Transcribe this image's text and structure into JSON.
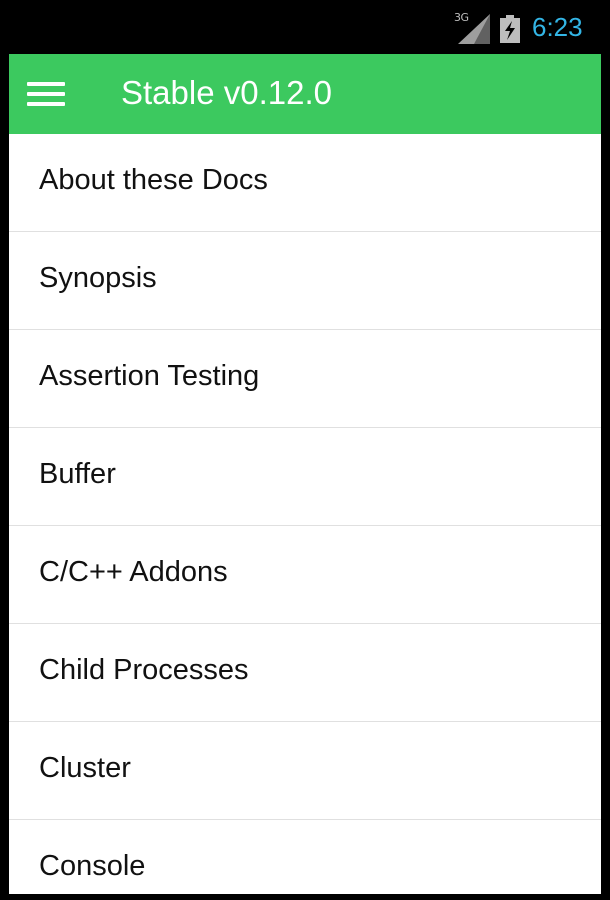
{
  "status_bar": {
    "network": "3G",
    "time": "6:23",
    "signal_icon": "signal-icon",
    "battery_icon": "battery-charging-icon",
    "time_color": "#33b5e5"
  },
  "app_bar": {
    "title": "Stable v0.12.0",
    "menu_icon": "hamburger-menu-icon",
    "background": "#3cc95f"
  },
  "nav": {
    "items": [
      {
        "label": "About these Docs"
      },
      {
        "label": "Synopsis"
      },
      {
        "label": "Assertion Testing"
      },
      {
        "label": "Buffer"
      },
      {
        "label": "C/C++ Addons"
      },
      {
        "label": "Child Processes"
      },
      {
        "label": "Cluster"
      },
      {
        "label": "Console"
      }
    ]
  }
}
